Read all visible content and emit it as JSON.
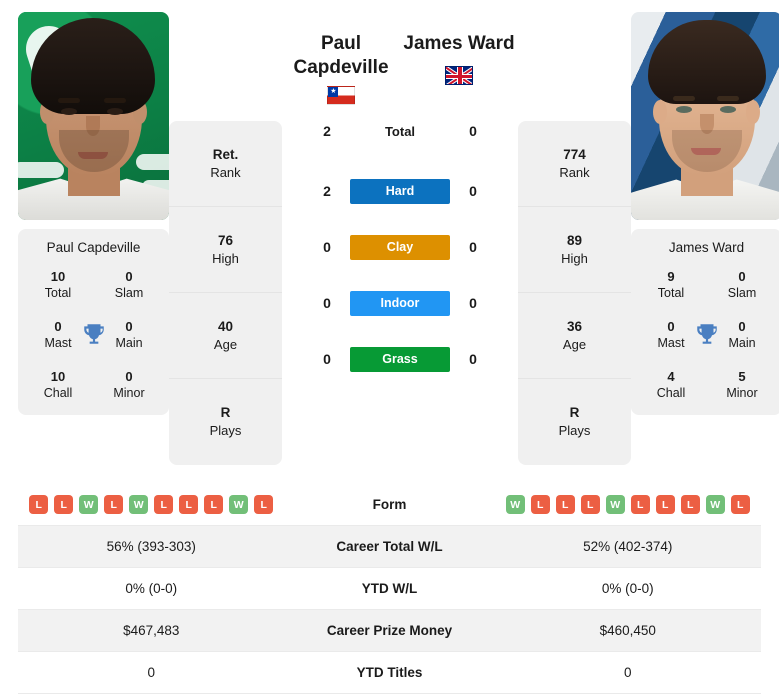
{
  "players": {
    "left": {
      "name_line1": "Paul",
      "name_line2": "Capdeville",
      "full_name": "Paul Capdeville",
      "flag": "chile-flag-icon",
      "photo_alt": "paul-capdeville-photo",
      "rank": {
        "value": "Ret.",
        "label": "Rank"
      },
      "high": {
        "value": "76",
        "label": "High"
      },
      "age": {
        "value": "40",
        "label": "Age"
      },
      "plays": {
        "value": "R",
        "label": "Plays"
      },
      "titles": {
        "total": {
          "value": "10",
          "label": "Total"
        },
        "slam": {
          "value": "0",
          "label": "Slam"
        },
        "mast": {
          "value": "0",
          "label": "Mast"
        },
        "main": {
          "value": "0",
          "label": "Main"
        },
        "chall": {
          "value": "10",
          "label": "Chall"
        },
        "minor": {
          "value": "0",
          "label": "Minor"
        }
      },
      "form": [
        "L",
        "L",
        "W",
        "L",
        "W",
        "L",
        "L",
        "L",
        "W",
        "L"
      ],
      "career_total_wl": "56% (393-303)",
      "ytd_wl": "0% (0-0)",
      "career_prize_money": "$467,483",
      "ytd_titles": "0"
    },
    "right": {
      "name_line1": "James Ward",
      "name_line2": "",
      "full_name": "James Ward",
      "flag": "united-kingdom-flag-icon",
      "photo_alt": "james-ward-photo",
      "rank": {
        "value": "774",
        "label": "Rank"
      },
      "high": {
        "value": "89",
        "label": "High"
      },
      "age": {
        "value": "36",
        "label": "Age"
      },
      "plays": {
        "value": "R",
        "label": "Plays"
      },
      "titles": {
        "total": {
          "value": "9",
          "label": "Total"
        },
        "slam": {
          "value": "0",
          "label": "Slam"
        },
        "mast": {
          "value": "0",
          "label": "Mast"
        },
        "main": {
          "value": "0",
          "label": "Main"
        },
        "chall": {
          "value": "4",
          "label": "Chall"
        },
        "minor": {
          "value": "5",
          "label": "Minor"
        }
      },
      "form": [
        "W",
        "L",
        "L",
        "L",
        "W",
        "L",
        "L",
        "L",
        "W",
        "L"
      ],
      "career_total_wl": "52% (402-374)",
      "ytd_wl": "0% (0-0)",
      "career_prize_money": "$460,450",
      "ytd_titles": "0"
    }
  },
  "head_to_head": {
    "total": {
      "label": "Total",
      "left": "2",
      "right": "0"
    },
    "surfaces": [
      {
        "label": "Hard",
        "left": "2",
        "right": "0",
        "color": "#0c72bf"
      },
      {
        "label": "Clay",
        "left": "0",
        "right": "0",
        "color": "#dd9000"
      },
      {
        "label": "Indoor",
        "left": "0",
        "right": "0",
        "color": "#2196f3"
      },
      {
        "label": "Grass",
        "left": "0",
        "right": "0",
        "color": "#079a35"
      }
    ]
  },
  "table": {
    "rows": [
      {
        "label": "Form"
      },
      {
        "label": "Career Total W/L"
      },
      {
        "label": "YTD W/L"
      },
      {
        "label": "Career Prize Money"
      },
      {
        "label": "YTD Titles"
      }
    ]
  },
  "icons": {
    "trophy": "trophy-icon"
  },
  "colors": {
    "win_badge": "#72bf78",
    "loss_badge": "#ec5f43",
    "panel": "#f0f0f0",
    "row_alt": "#f2f2f2"
  }
}
